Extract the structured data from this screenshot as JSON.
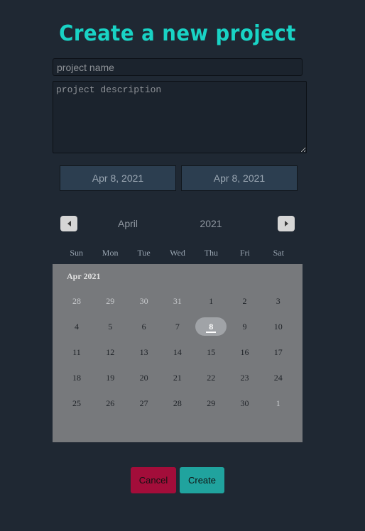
{
  "page": {
    "title": "Create a new project"
  },
  "form": {
    "name_placeholder": "project name",
    "name_value": "",
    "description_placeholder": "project description",
    "description_value": "",
    "start_date": "Apr 8, 2021",
    "end_date": "Apr 8, 2021"
  },
  "calendar": {
    "month": "April",
    "year": "2021",
    "caption": "Apr 2021",
    "weekdays": [
      "Sun",
      "Mon",
      "Tue",
      "Wed",
      "Thu",
      "Fri",
      "Sat"
    ],
    "weeks": [
      [
        "28",
        "29",
        "30",
        "31",
        "1",
        "2",
        "3"
      ],
      [
        "4",
        "5",
        "6",
        "7",
        "8",
        "9",
        "10"
      ],
      [
        "11",
        "12",
        "13",
        "14",
        "15",
        "16",
        "17"
      ],
      [
        "18",
        "19",
        "20",
        "21",
        "22",
        "23",
        "24"
      ],
      [
        "25",
        "26",
        "27",
        "28",
        "29",
        "30",
        "1"
      ]
    ],
    "selected_day": "8",
    "prev_icon": "triangle-left-icon",
    "next_icon": "triangle-right-icon"
  },
  "actions": {
    "cancel_label": "Cancel",
    "create_label": "Create"
  },
  "colors": {
    "background": "#1f2833",
    "title": "#19d3c5",
    "cancel": "#a30d3a",
    "create": "#20a39e",
    "calendar_panel": "#77797c"
  }
}
